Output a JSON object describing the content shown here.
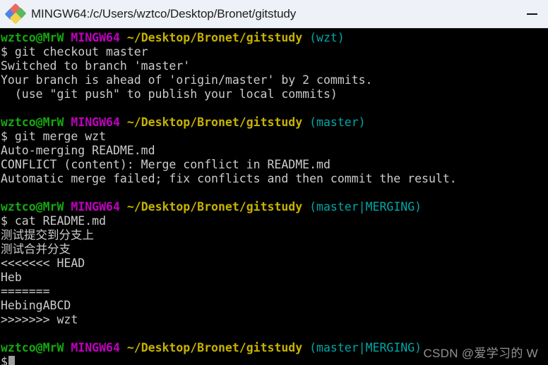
{
  "window": {
    "title": "MINGW64:/c/Users/wztco/Desktop/Bronet/gitstudy",
    "icon": "git-bash-icon",
    "minimize_label": "—",
    "titlebar_bg": "#eef1f7",
    "terminal_bg": "#000000"
  },
  "colors": {
    "user": "#16a810",
    "host": "#c000c0",
    "path": "#c7b300",
    "branch": "#00a8a8",
    "text": "#cccccc"
  },
  "prompt": {
    "user_host": "wztco@MrW",
    "shell": "MINGW64",
    "path": "~/Desktop/Bronet/gitstudy",
    "symbol": "$"
  },
  "terminal": {
    "blocks": [
      {
        "name": "checkout-block",
        "branch": "(wzt)",
        "command": "git checkout master",
        "output": [
          "Switched to branch 'master'",
          "Your branch is ahead of 'origin/master' by 2 commits.",
          "  (use \"git push\" to publish your local commits)"
        ]
      },
      {
        "name": "merge-block",
        "branch": "(master)",
        "command": "git merge wzt",
        "output": [
          "Auto-merging README.md",
          "CONFLICT (content): Merge conflict in README.md",
          "Automatic merge failed; fix conflicts and then commit the result."
        ]
      },
      {
        "name": "cat-readme-block",
        "branch": "(master|MERGING)",
        "command": "cat README.md",
        "output": [
          "测试提交到分支上",
          "测试合并分支",
          "<<<<<<< HEAD",
          "Heb",
          "=======",
          "HebingABCD",
          ">>>>>>> wzt"
        ]
      }
    ],
    "final_prompt": {
      "name": "active-prompt",
      "branch": "(master|MERGING)",
      "command": ""
    }
  },
  "watermark": {
    "text": "CSDN @爱学习的 W"
  }
}
